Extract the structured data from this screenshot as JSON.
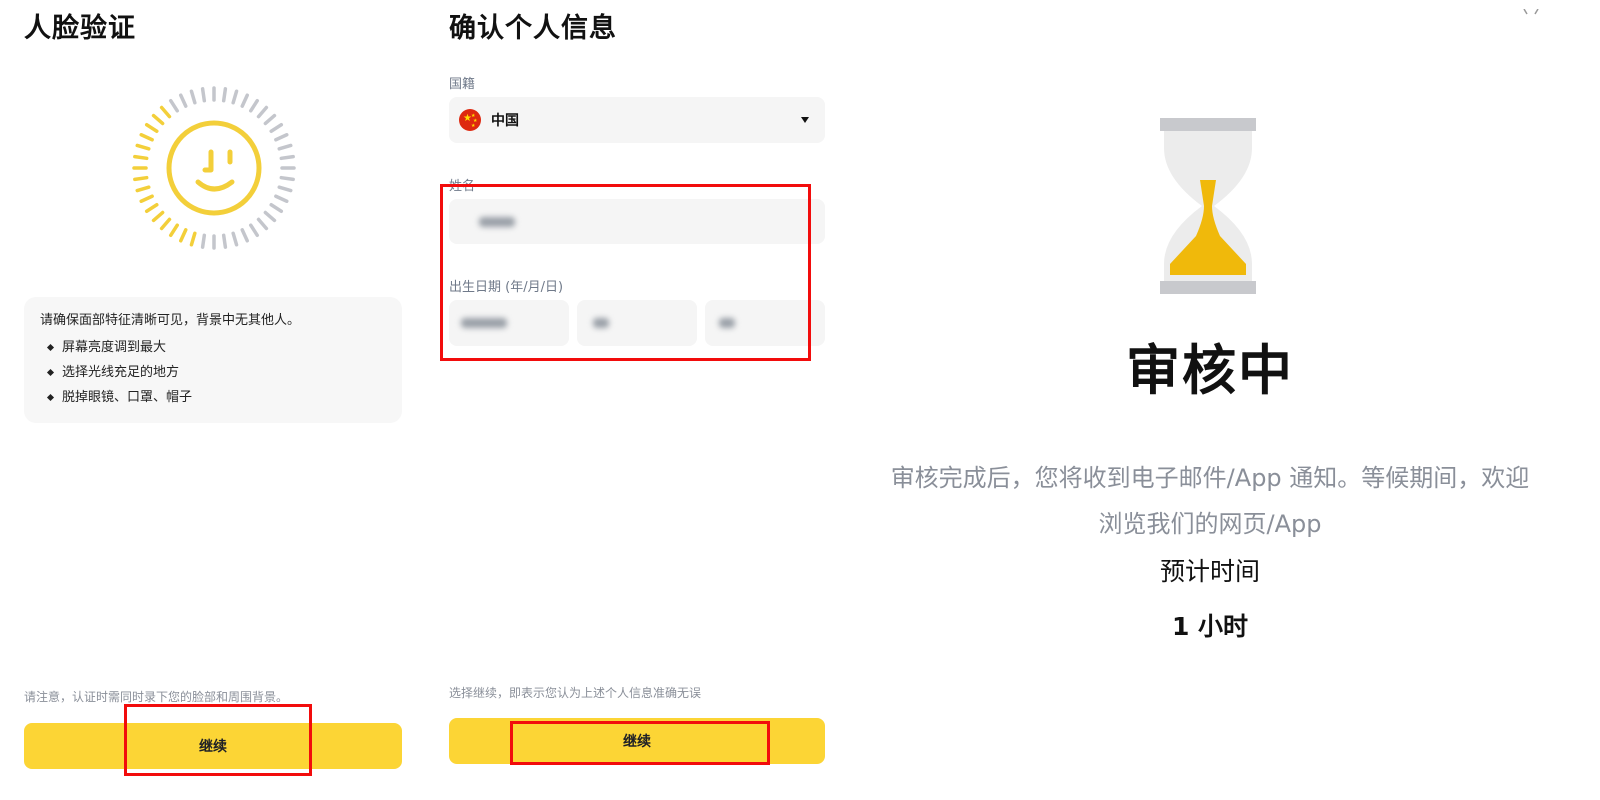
{
  "face_verification": {
    "title": "人脸验证",
    "tips_intro": "请确保面部特征清晰可见，背景中无其他人。",
    "tips": [
      "屏幕亮度调到最大",
      "选择光线充足的地方",
      "脱掉眼镜、口罩、帽子"
    ],
    "notice": "请注意，认证时需同时录下您的脸部和周围背景。",
    "continue_label": "继续"
  },
  "confirm_info": {
    "title": "确认个人信息",
    "nationality_label": "国籍",
    "nationality_value": "中国",
    "name_label": "姓名",
    "dob_label": "出生日期 (年/月/日)",
    "disclaimer": "选择继续，即表示您认为上述个人信息准确无误",
    "continue_label": "继续"
  },
  "review": {
    "title": "审核中",
    "description": "审核完成后，您将收到电子邮件/App 通知。等候期间，欢迎浏览我们的网页/App",
    "eta_label": "预计时间",
    "eta_value": "1 小时"
  },
  "colors": {
    "accent": "#fcd535",
    "highlight": "#f20c0c",
    "field_bg": "#f5f5f5",
    "muted_text": "#8a8f99"
  },
  "icons": [
    "face-scan-icon",
    "china-flag-icon",
    "caret-down-icon",
    "hourglass-icon"
  ]
}
